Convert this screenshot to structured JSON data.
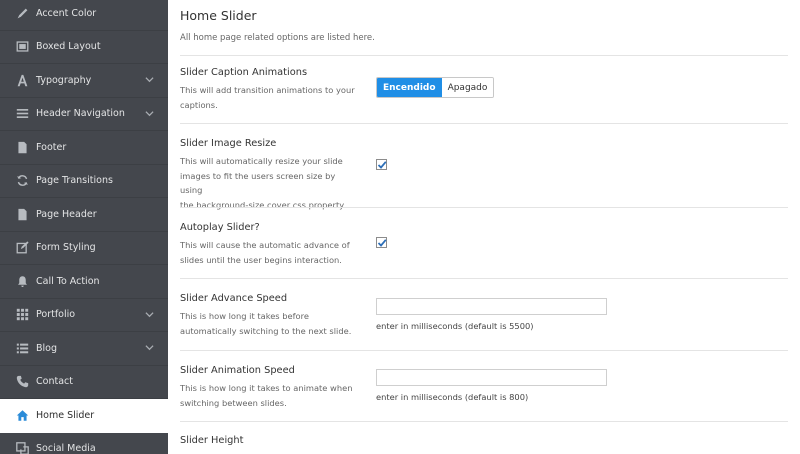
{
  "sidebar": {
    "items": [
      {
        "label": "Accent Color",
        "icon": "brush-icon",
        "expandable": false
      },
      {
        "label": "Boxed Layout",
        "icon": "boxed-layout-icon",
        "expandable": false
      },
      {
        "label": "Typography",
        "icon": "typography-icon",
        "expandable": true
      },
      {
        "label": "Header Navigation",
        "icon": "menu-icon",
        "expandable": true
      },
      {
        "label": "Footer",
        "icon": "footer-icon",
        "expandable": false
      },
      {
        "label": "Page Transitions",
        "icon": "refresh-icon",
        "expandable": false
      },
      {
        "label": "Page Header",
        "icon": "page-header-icon",
        "expandable": false
      },
      {
        "label": "Form Styling",
        "icon": "edit-icon",
        "expandable": false
      },
      {
        "label": "Call To Action",
        "icon": "bell-icon",
        "expandable": false
      },
      {
        "label": "Portfolio",
        "icon": "grid-icon",
        "expandable": true
      },
      {
        "label": "Blog",
        "icon": "list-icon",
        "expandable": true
      },
      {
        "label": "Contact",
        "icon": "phone-icon",
        "expandable": false
      },
      {
        "label": "Home Slider",
        "icon": "home-icon",
        "expandable": false,
        "active": true
      },
      {
        "label": "Social Media",
        "icon": "share-icon",
        "expandable": false
      }
    ],
    "accent_color": "#1f8ee6"
  },
  "main": {
    "title": "Home Slider",
    "description": "All home page related options are listed here.",
    "options": {
      "caption_animations": {
        "label": "Slider Caption Animations",
        "desc_lines": [
          "This will add transition animations to your",
          "captions."
        ],
        "toggle_on": "Encendido",
        "toggle_off": "Apagado",
        "state": "on"
      },
      "image_resize": {
        "label": "Slider Image Resize",
        "desc_lines": [
          "This will automatically resize your slide",
          "images to fit the users screen size by using",
          "the background-size cover css property."
        ],
        "checked": true
      },
      "autoplay": {
        "label": "Autoplay Slider?",
        "desc_lines": [
          "This will cause the automatic advance of",
          "slides until the user begins interaction."
        ],
        "checked": true
      },
      "advance_speed": {
        "label": "Slider Advance Speed",
        "desc_lines": [
          "This is how long it takes before",
          "automatically switching to the next slide."
        ],
        "value": "",
        "hint": "enter in milliseconds (default is 5500)"
      },
      "animation_speed": {
        "label": "Slider Animation Speed",
        "desc_lines": [
          "This is how long it takes to animate when",
          "switching between slides."
        ],
        "value": "",
        "hint": "enter in milliseconds (default is 800)"
      },
      "height": {
        "label": "Slider Height"
      }
    }
  }
}
